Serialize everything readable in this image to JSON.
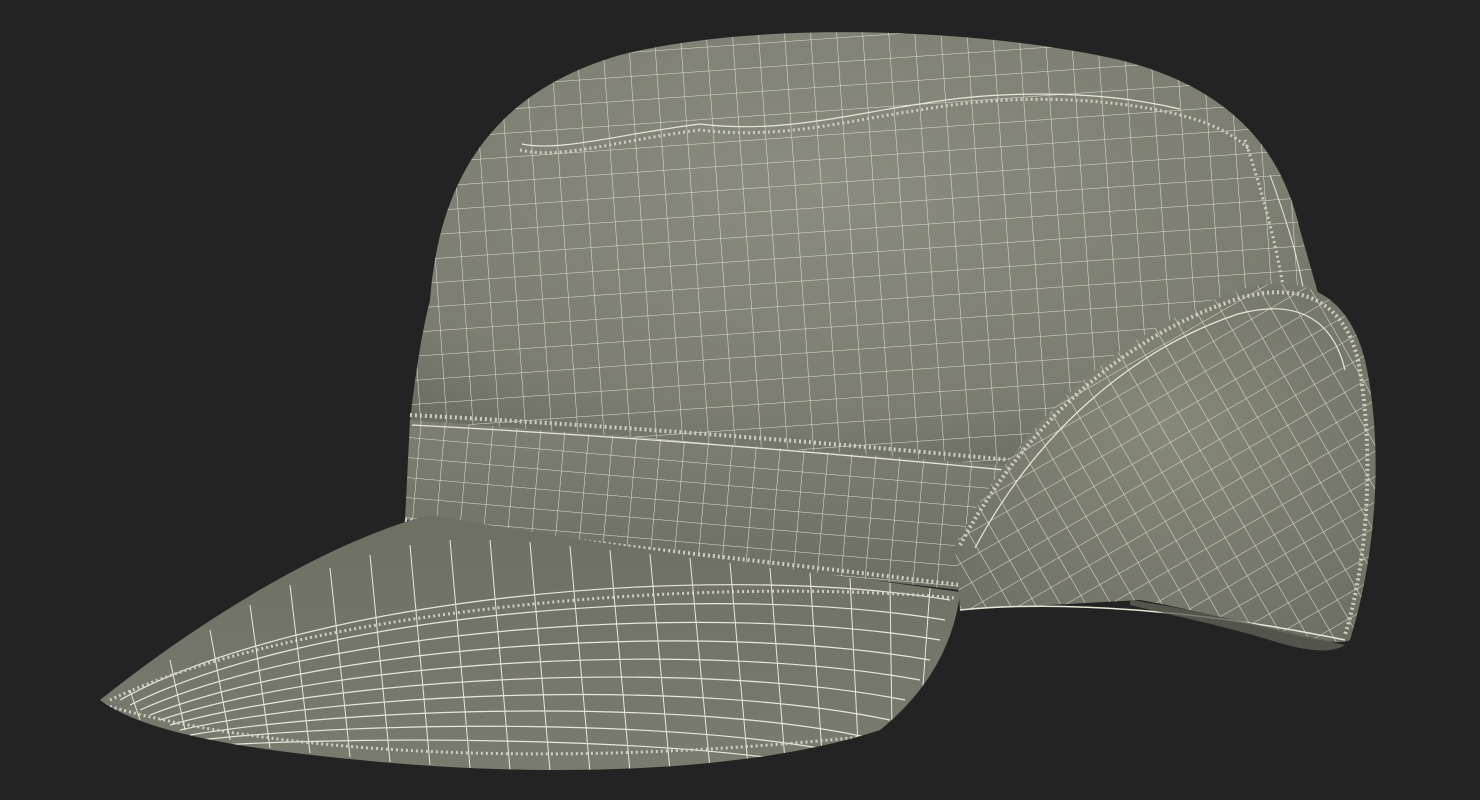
{
  "scene": {
    "subject": "cap-wireframe",
    "colors": {
      "background": "#232323",
      "surface": "#7f8073",
      "surface_dark": "#6a6b60",
      "surface_light": "#8c8d80",
      "wire": "#e9e7d9",
      "seam": "#cfcdbf"
    }
  }
}
